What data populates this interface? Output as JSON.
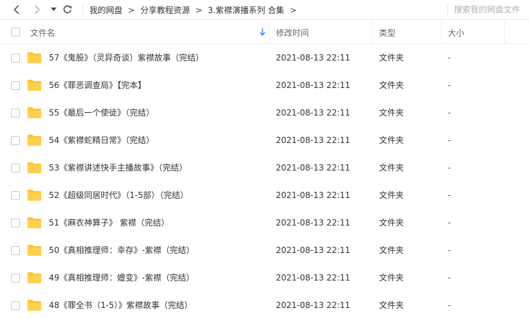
{
  "breadcrumb": {
    "items": [
      "我的网盘",
      "分享教程资源",
      "3.紫襟演播系列 合集"
    ],
    "separator": ">"
  },
  "search": {
    "placeholder": "搜索我的网盘文件"
  },
  "columns": {
    "name": "文件名",
    "mtime": "修改时间",
    "type": "类型",
    "size": "大小"
  },
  "sort_indicator": {
    "icon": "arrow-down-icon",
    "color": "#3b8cff"
  },
  "colors": {
    "folder": "#ffc433",
    "accent": "#3b8cff"
  },
  "files": [
    {
      "name": "57《鬼股》（灵异奇谈）紫襟故事（完结）",
      "mtime": "2021-08-13 22:11",
      "type": "文件夹",
      "size": "-"
    },
    {
      "name": "56《罪恶调查局》【完本】",
      "mtime": "2021-08-13 22:11",
      "type": "文件夹",
      "size": "-"
    },
    {
      "name": "55《最后一个使徒》（完结）",
      "mtime": "2021-08-13 22:11",
      "type": "文件夹",
      "size": "-"
    },
    {
      "name": "54《紫襟蛇精日常》（完结）",
      "mtime": "2021-08-13 22:11",
      "type": "文件夹",
      "size": "-"
    },
    {
      "name": "53《紫襟讲述快手主播故事》（完结）",
      "mtime": "2021-08-13 22:11",
      "type": "文件夹",
      "size": "-"
    },
    {
      "name": "52《超级同居时代》（1-5部）（完结）",
      "mtime": "2021-08-13 22:11",
      "type": "文件夹",
      "size": "-"
    },
    {
      "name": "51《麻衣神算子》 紫襟（完结）",
      "mtime": "2021-08-13 22:11",
      "type": "文件夹",
      "size": "-"
    },
    {
      "name": "50《真相推理师：幸存》-紫襟（完结）",
      "mtime": "2021-08-13 22:11",
      "type": "文件夹",
      "size": "-"
    },
    {
      "name": "49《真相推理师：嬗变》-紫襟（完结）",
      "mtime": "2021-08-13 22:11",
      "type": "文件夹",
      "size": "-"
    },
    {
      "name": "48《罪全书（1-5）》紫襟故事（完结）",
      "mtime": "2021-08-13 22:11",
      "type": "文件夹",
      "size": "-"
    }
  ]
}
